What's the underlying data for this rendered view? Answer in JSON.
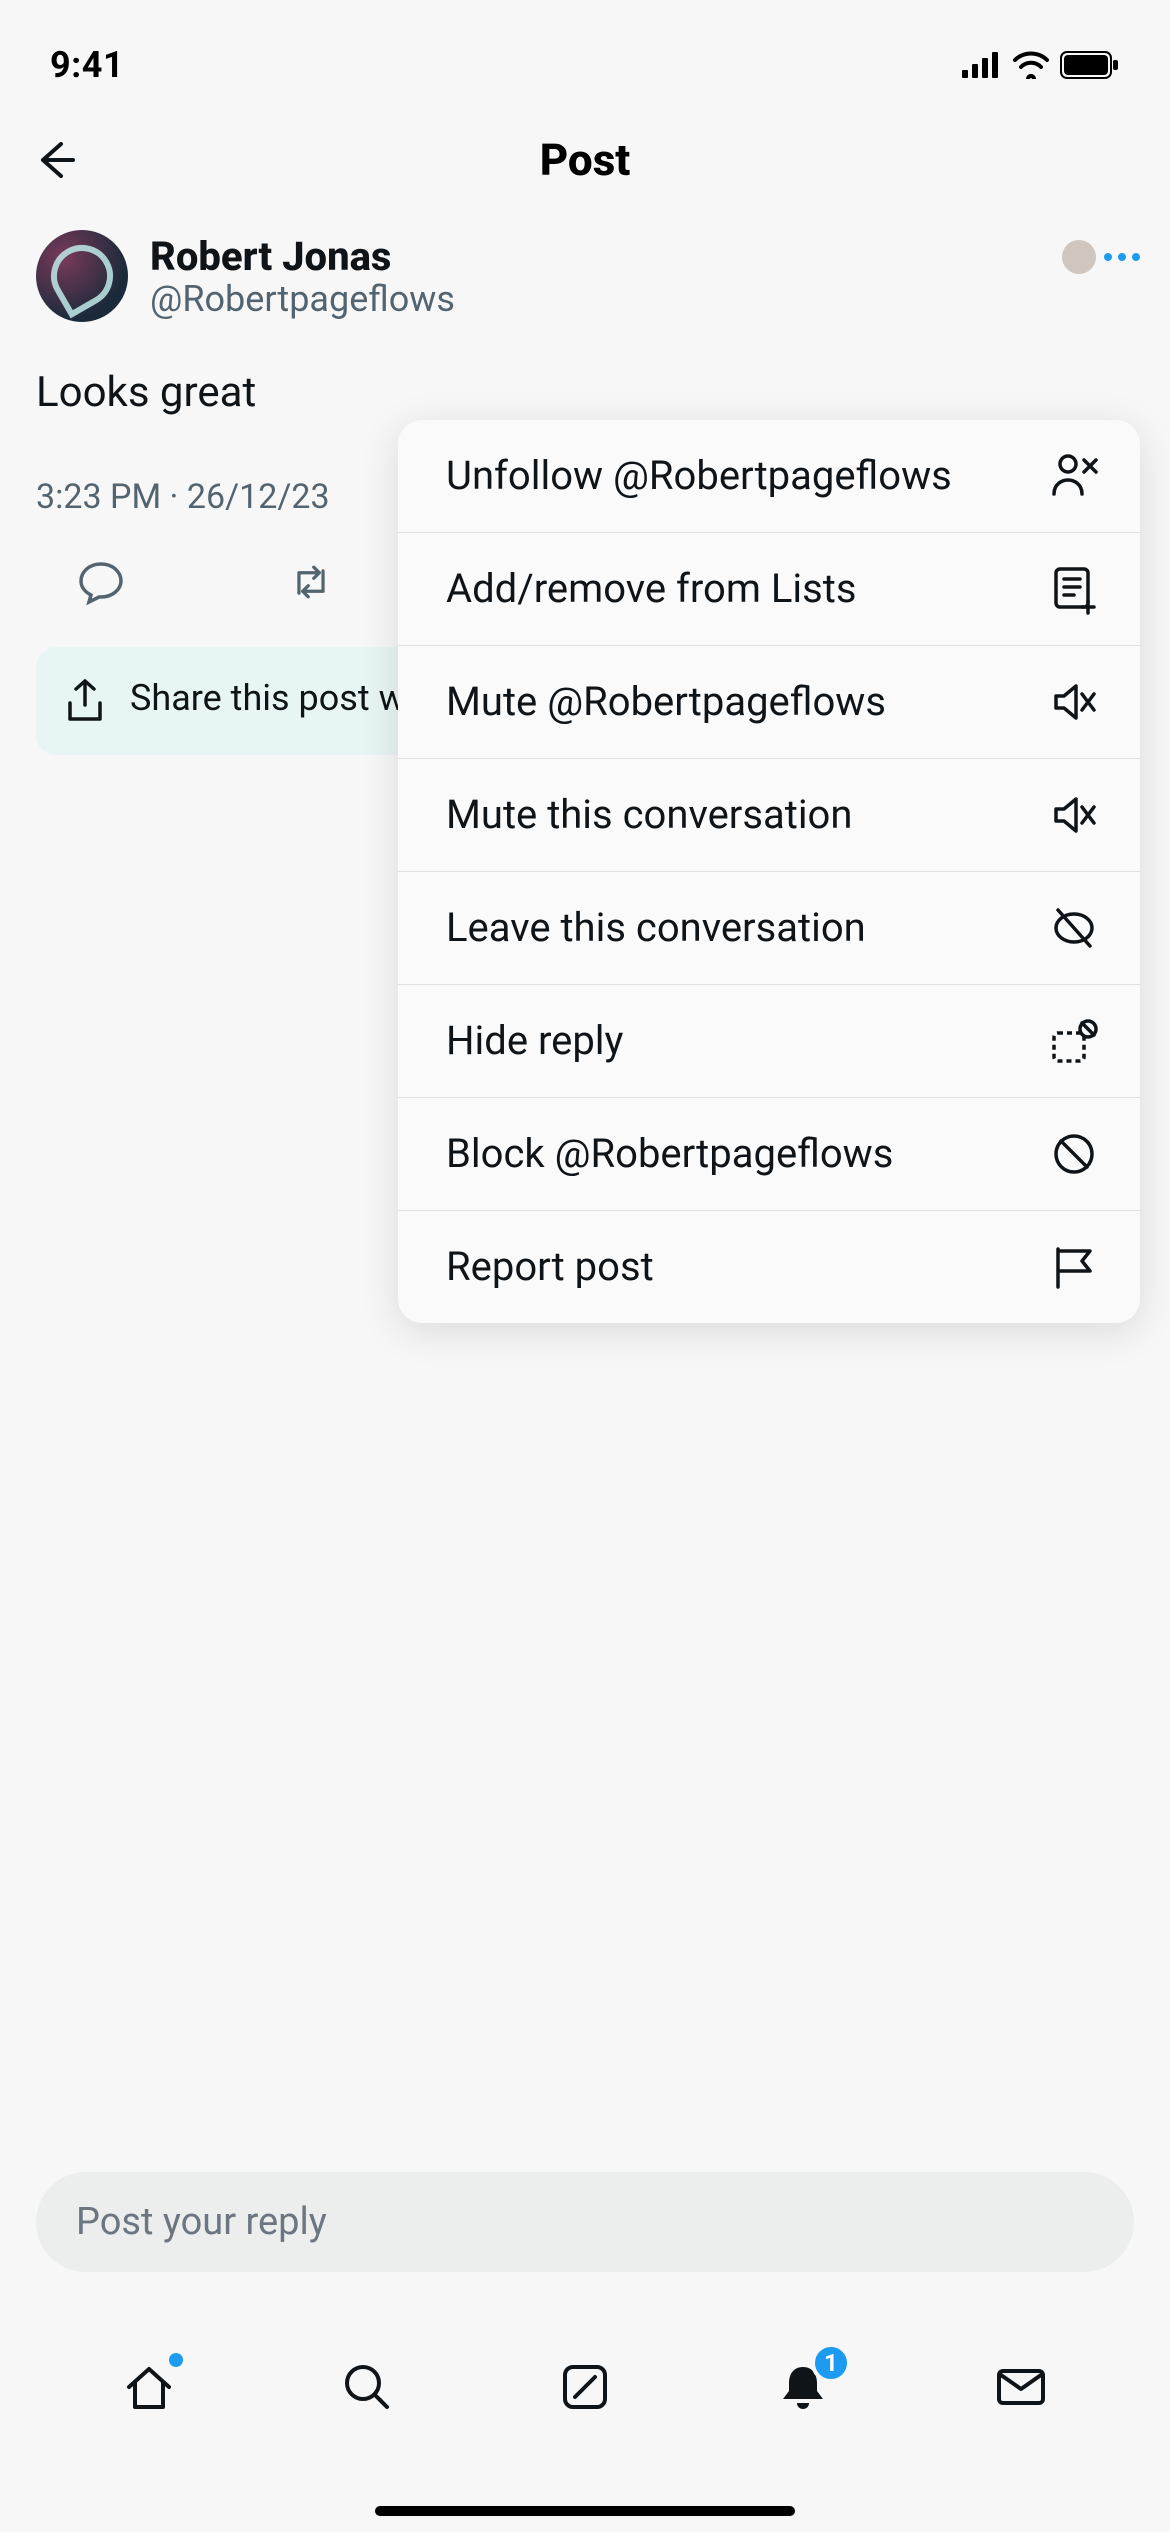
{
  "status": {
    "time": "9:41"
  },
  "header": {
    "title": "Post"
  },
  "post": {
    "display_name": "Robert Jonas",
    "handle": "@Robertpageflows",
    "text": "Looks great",
    "meta": "3:23 PM · 26/12/23"
  },
  "share_box": {
    "text": "Share this post with followers who aren't on X"
  },
  "menu": {
    "items": [
      {
        "label": "Unfollow @Robertpageflows",
        "icon": "user-remove-icon"
      },
      {
        "label": "Add/remove from Lists",
        "icon": "list-add-icon"
      },
      {
        "label": "Mute @Robertpageflows",
        "icon": "mute-icon"
      },
      {
        "label": "Mute this conversation",
        "icon": "mute-icon"
      },
      {
        "label": "Leave this conversation",
        "icon": "leave-icon"
      },
      {
        "label": "Hide reply",
        "icon": "hide-reply-icon"
      },
      {
        "label": "Block @Robertpageflows",
        "icon": "block-icon"
      },
      {
        "label": "Report post",
        "icon": "flag-icon"
      }
    ]
  },
  "reply": {
    "placeholder": "Post your reply"
  },
  "tabs": {
    "notifications_badge": "1"
  }
}
